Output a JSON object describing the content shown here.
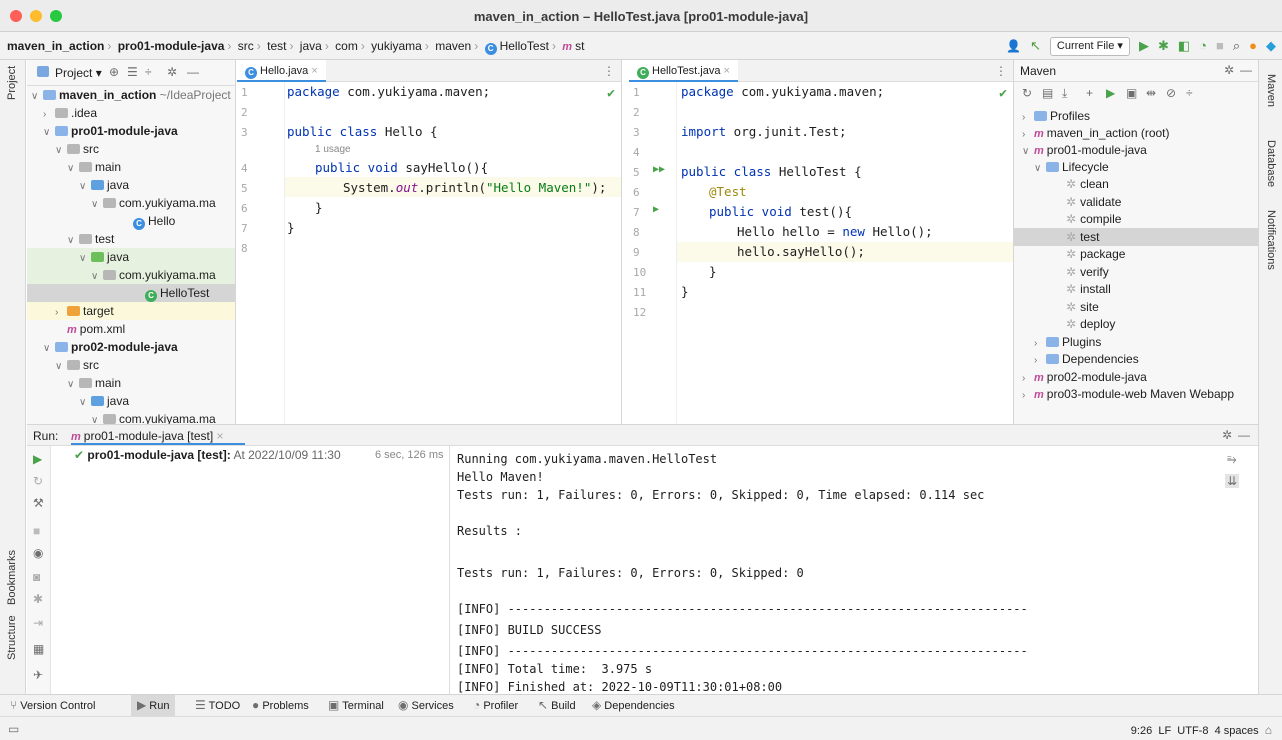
{
  "window": {
    "title": "maven_in_action – HelloTest.java [pro01-module-java]"
  },
  "breadcrumb": [
    "maven_in_action",
    "pro01-module-java",
    "src",
    "test",
    "java",
    "com",
    "yukiyama",
    "maven",
    "HelloTest",
    "st"
  ],
  "toolbar": {
    "run_config": "Current File"
  },
  "left_strip": {
    "project": "Project",
    "bookmarks": "Bookmarks",
    "structure": "Structure"
  },
  "right_strip": {
    "maven": "Maven",
    "database": "Database",
    "notifications": "Notifications"
  },
  "project": {
    "header": "Project",
    "items": [
      {
        "label": "maven_in_action",
        "extra": " ~/IdeaProject",
        "bold": true
      },
      {
        "label": ".idea"
      },
      {
        "label": "pro01-module-java",
        "bold": true
      },
      {
        "label": "src"
      },
      {
        "label": "main"
      },
      {
        "label": "java"
      },
      {
        "label": "com.yukiyama.ma"
      },
      {
        "label": "Hello"
      },
      {
        "label": "test"
      },
      {
        "label": "java"
      },
      {
        "label": "com.yukiyama.ma"
      },
      {
        "label": "HelloTest"
      },
      {
        "label": "target"
      },
      {
        "label": "pom.xml"
      },
      {
        "label": "pro02-module-java",
        "bold": true
      },
      {
        "label": "src"
      },
      {
        "label": "main"
      },
      {
        "label": "java"
      },
      {
        "label": "com.yukiyama.ma"
      }
    ]
  },
  "editor_left": {
    "tab": "Hello.java",
    "lines": [
      "1",
      "2",
      "3",
      "4",
      "5",
      "6",
      "7",
      "8"
    ],
    "code": {
      "l1a": "package",
      "l1b": " com.yukiyama.maven;",
      "l3a": "public class",
      "l3b": " Hello {",
      "usage": "1 usage",
      "l4a": "public void",
      "l4b": " sayHello(){",
      "l5a": "System.",
      "l5b": "out",
      "l5c": ".println(",
      "l5d": "\"Hello Maven!\"",
      "l5e": ");",
      "l6": "}",
      "l7": "}"
    }
  },
  "editor_right": {
    "tab": "HelloTest.java",
    "lines": [
      "1",
      "2",
      "3",
      "4",
      "5",
      "6",
      "7",
      "8",
      "9",
      "10",
      "11",
      "12"
    ],
    "code": {
      "l1a": "package",
      "l1b": " com.yukiyama.maven;",
      "l3a": "import",
      "l3b": " org.junit.Test;",
      "l5a": "public class",
      "l5b": " HelloTest {",
      "l6": "@Test",
      "l7a": "public void",
      "l7b": " test(){",
      "l8a": "Hello hello = ",
      "l8b": "new",
      "l8c": " Hello();",
      "l9": "hello.sayHello();",
      "l10": "}",
      "l11": "}"
    }
  },
  "maven": {
    "header": "Maven",
    "items": [
      "Profiles",
      "maven_in_action (root)",
      "pro01-module-java",
      "Lifecycle",
      "clean",
      "validate",
      "compile",
      "test",
      "package",
      "verify",
      "install",
      "site",
      "deploy",
      "Plugins",
      "Dependencies",
      "pro02-module-java",
      "pro03-module-web Maven Webapp"
    ]
  },
  "run": {
    "label": "Run:",
    "tab": "pro01-module-java [test]",
    "tree_title": "pro01-module-java [test]:",
    "tree_time": " At 2022/10/09 11:30",
    "tree_duration": "6 sec, 126 ms",
    "console": [
      "Running com.yukiyama.maven.HelloTest",
      "Hello Maven!",
      "Tests run: 1, Failures: 0, Errors: 0, Skipped: 0, Time elapsed: 0.114 sec",
      "",
      "Results :",
      "",
      "Tests run: 1, Failures: 0, Errors: 0, Skipped: 0",
      "",
      "[INFO] ------------------------------------------------------------------------",
      "[INFO] BUILD SUCCESS",
      "[INFO] ------------------------------------------------------------------------",
      "[INFO] Total time:  3.975 s",
      "[INFO] Finished at: 2022-10-09T11:30:01+08:00"
    ]
  },
  "bottom_tabs": [
    "Version Control",
    "Run",
    "TODO",
    "Problems",
    "Terminal",
    "Services",
    "Profiler",
    "Build",
    "Dependencies"
  ],
  "status": {
    "position": "9:26",
    "line_sep": "LF",
    "encoding": "UTF-8",
    "indent": "4 spaces"
  }
}
